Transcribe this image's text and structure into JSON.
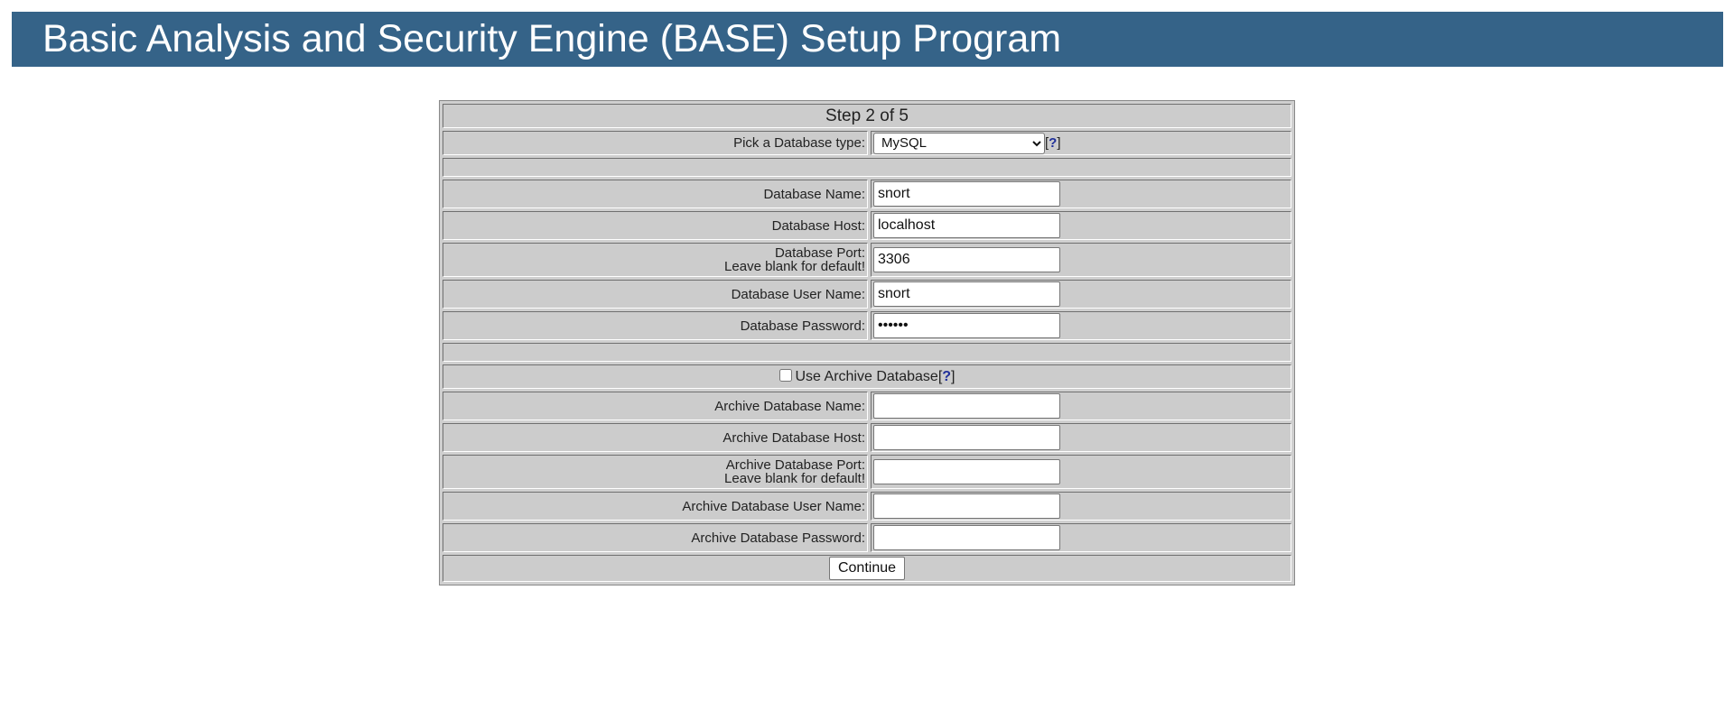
{
  "header": {
    "title": "Basic Analysis and Security Engine (BASE) Setup Program"
  },
  "step": {
    "title": "Step 2 of 5"
  },
  "db_type": {
    "label": "Pick a Database type:",
    "selected": "MySQL",
    "help_open": "[",
    "help_mark": "?",
    "help_close": "]"
  },
  "database": {
    "name_label": "Database Name:",
    "name_value": "snort",
    "host_label": "Database Host:",
    "host_value": "localhost",
    "port_label": "Database Port:",
    "port_note": "Leave blank for default!",
    "port_value": "3306",
    "user_label": "Database User Name:",
    "user_value": "snort",
    "password_label": "Database Password:",
    "password_value": "••••••"
  },
  "archive": {
    "checkbox_label": "Use Archive Database",
    "checked": false,
    "help_open": "[",
    "help_mark": "?",
    "help_close": "]",
    "name_label": "Archive Database Name:",
    "name_value": "",
    "host_label": "Archive Database Host:",
    "host_value": "",
    "port_label": "Archive Database Port:",
    "port_note": "Leave blank for default!",
    "port_value": "",
    "user_label": "Archive Database User Name:",
    "user_value": "",
    "password_label": "Archive Database Password:",
    "password_value": ""
  },
  "actions": {
    "continue_label": "Continue"
  },
  "colors": {
    "header_bg": "#356388",
    "table_bg": "#cccccc",
    "help_link": "#1f2f9a"
  }
}
